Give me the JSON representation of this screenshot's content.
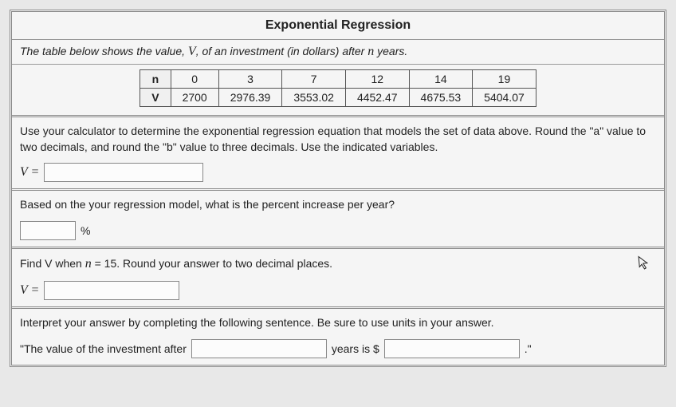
{
  "title": "Exponential Regression",
  "subtitle_pre": "The table below shows the value, ",
  "subtitle_var1": "V",
  "subtitle_mid": ", of an investment (in dollars) after ",
  "subtitle_var2": "n",
  "subtitle_post": " years.",
  "table": {
    "row_headers": [
      "n",
      "V"
    ],
    "n": [
      "0",
      "3",
      "7",
      "12",
      "14",
      "19"
    ],
    "V": [
      "2700",
      "2976.39",
      "3553.02",
      "4452.47",
      "4675.53",
      "5404.07"
    ]
  },
  "q1_text": "Use your calculator to determine the exponential regression equation that models the set of data above. Round the \"a\" value to two decimals, and round the \"b\" value to three decimals. Use the indicated variables.",
  "q1_label": "V =",
  "q2_text": "Based on the your regression model, what is the percent increase per year?",
  "q2_suffix": "%",
  "q3_pre": "Find V when ",
  "q3_var": "n",
  "q3_post": " = 15. Round your answer to two decimal places.",
  "q3_label": "V =",
  "q4_text": "Interpret your answer by completing the following sentence. Be sure to use units in your answer.",
  "q4_sent_pre": "\"The value of the investment after ",
  "q4_sent_mid": " years is $",
  "q4_sent_post": " .\""
}
